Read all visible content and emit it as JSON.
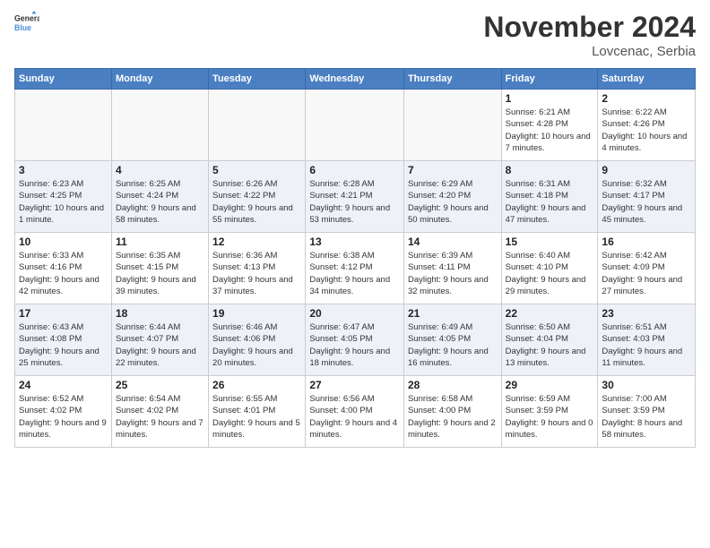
{
  "logo": {
    "line1": "General",
    "line2": "Blue"
  },
  "title": "November 2024",
  "subtitle": "Lovcenac, Serbia",
  "days_of_week": [
    "Sunday",
    "Monday",
    "Tuesday",
    "Wednesday",
    "Thursday",
    "Friday",
    "Saturday"
  ],
  "weeks": [
    [
      {
        "day": "",
        "info": ""
      },
      {
        "day": "",
        "info": ""
      },
      {
        "day": "",
        "info": ""
      },
      {
        "day": "",
        "info": ""
      },
      {
        "day": "",
        "info": ""
      },
      {
        "day": "1",
        "info": "Sunrise: 6:21 AM\nSunset: 4:28 PM\nDaylight: 10 hours and 7 minutes."
      },
      {
        "day": "2",
        "info": "Sunrise: 6:22 AM\nSunset: 4:26 PM\nDaylight: 10 hours and 4 minutes."
      }
    ],
    [
      {
        "day": "3",
        "info": "Sunrise: 6:23 AM\nSunset: 4:25 PM\nDaylight: 10 hours and 1 minute."
      },
      {
        "day": "4",
        "info": "Sunrise: 6:25 AM\nSunset: 4:24 PM\nDaylight: 9 hours and 58 minutes."
      },
      {
        "day": "5",
        "info": "Sunrise: 6:26 AM\nSunset: 4:22 PM\nDaylight: 9 hours and 55 minutes."
      },
      {
        "day": "6",
        "info": "Sunrise: 6:28 AM\nSunset: 4:21 PM\nDaylight: 9 hours and 53 minutes."
      },
      {
        "day": "7",
        "info": "Sunrise: 6:29 AM\nSunset: 4:20 PM\nDaylight: 9 hours and 50 minutes."
      },
      {
        "day": "8",
        "info": "Sunrise: 6:31 AM\nSunset: 4:18 PM\nDaylight: 9 hours and 47 minutes."
      },
      {
        "day": "9",
        "info": "Sunrise: 6:32 AM\nSunset: 4:17 PM\nDaylight: 9 hours and 45 minutes."
      }
    ],
    [
      {
        "day": "10",
        "info": "Sunrise: 6:33 AM\nSunset: 4:16 PM\nDaylight: 9 hours and 42 minutes."
      },
      {
        "day": "11",
        "info": "Sunrise: 6:35 AM\nSunset: 4:15 PM\nDaylight: 9 hours and 39 minutes."
      },
      {
        "day": "12",
        "info": "Sunrise: 6:36 AM\nSunset: 4:13 PM\nDaylight: 9 hours and 37 minutes."
      },
      {
        "day": "13",
        "info": "Sunrise: 6:38 AM\nSunset: 4:12 PM\nDaylight: 9 hours and 34 minutes."
      },
      {
        "day": "14",
        "info": "Sunrise: 6:39 AM\nSunset: 4:11 PM\nDaylight: 9 hours and 32 minutes."
      },
      {
        "day": "15",
        "info": "Sunrise: 6:40 AM\nSunset: 4:10 PM\nDaylight: 9 hours and 29 minutes."
      },
      {
        "day": "16",
        "info": "Sunrise: 6:42 AM\nSunset: 4:09 PM\nDaylight: 9 hours and 27 minutes."
      }
    ],
    [
      {
        "day": "17",
        "info": "Sunrise: 6:43 AM\nSunset: 4:08 PM\nDaylight: 9 hours and 25 minutes."
      },
      {
        "day": "18",
        "info": "Sunrise: 6:44 AM\nSunset: 4:07 PM\nDaylight: 9 hours and 22 minutes."
      },
      {
        "day": "19",
        "info": "Sunrise: 6:46 AM\nSunset: 4:06 PM\nDaylight: 9 hours and 20 minutes."
      },
      {
        "day": "20",
        "info": "Sunrise: 6:47 AM\nSunset: 4:05 PM\nDaylight: 9 hours and 18 minutes."
      },
      {
        "day": "21",
        "info": "Sunrise: 6:49 AM\nSunset: 4:05 PM\nDaylight: 9 hours and 16 minutes."
      },
      {
        "day": "22",
        "info": "Sunrise: 6:50 AM\nSunset: 4:04 PM\nDaylight: 9 hours and 13 minutes."
      },
      {
        "day": "23",
        "info": "Sunrise: 6:51 AM\nSunset: 4:03 PM\nDaylight: 9 hours and 11 minutes."
      }
    ],
    [
      {
        "day": "24",
        "info": "Sunrise: 6:52 AM\nSunset: 4:02 PM\nDaylight: 9 hours and 9 minutes."
      },
      {
        "day": "25",
        "info": "Sunrise: 6:54 AM\nSunset: 4:02 PM\nDaylight: 9 hours and 7 minutes."
      },
      {
        "day": "26",
        "info": "Sunrise: 6:55 AM\nSunset: 4:01 PM\nDaylight: 9 hours and 5 minutes."
      },
      {
        "day": "27",
        "info": "Sunrise: 6:56 AM\nSunset: 4:00 PM\nDaylight: 9 hours and 4 minutes."
      },
      {
        "day": "28",
        "info": "Sunrise: 6:58 AM\nSunset: 4:00 PM\nDaylight: 9 hours and 2 minutes."
      },
      {
        "day": "29",
        "info": "Sunrise: 6:59 AM\nSunset: 3:59 PM\nDaylight: 9 hours and 0 minutes."
      },
      {
        "day": "30",
        "info": "Sunrise: 7:00 AM\nSunset: 3:59 PM\nDaylight: 8 hours and 58 minutes."
      }
    ]
  ]
}
